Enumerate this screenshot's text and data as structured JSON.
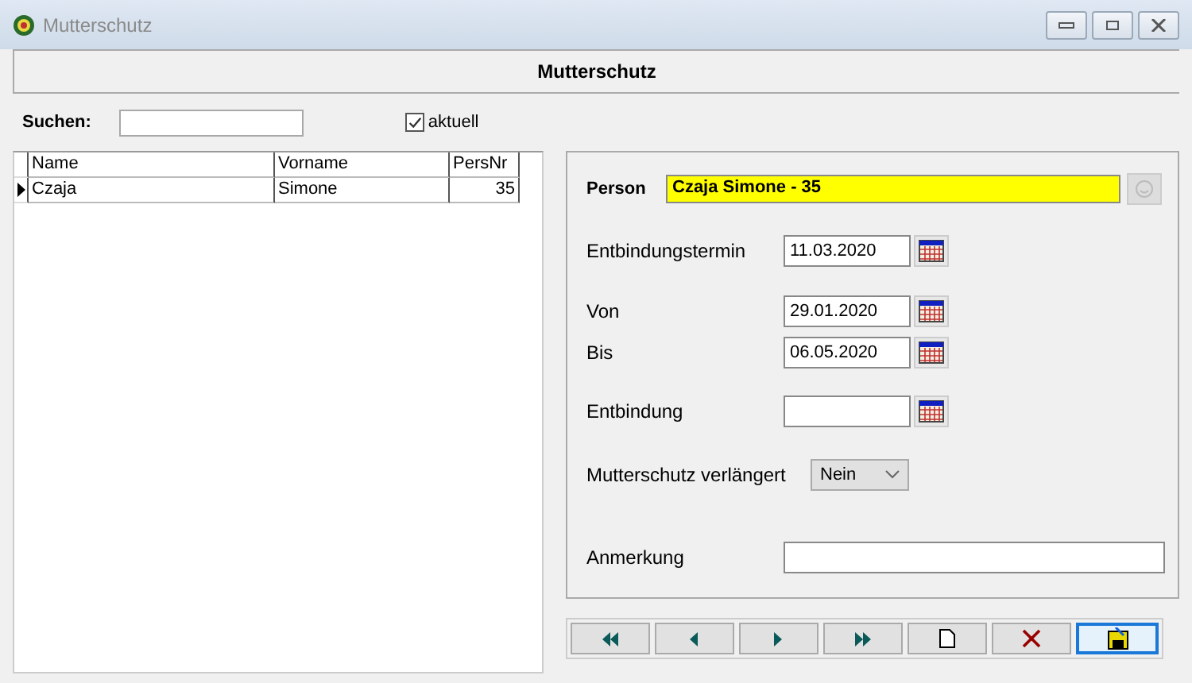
{
  "window": {
    "title": "Mutterschutz"
  },
  "header": "Mutterschutz",
  "search": {
    "label": "Suchen:"
  },
  "current_filter": {
    "label": "aktuell",
    "checked": true
  },
  "table": {
    "columns": [
      "Name",
      "Vorname",
      "PersNr"
    ],
    "rows": [
      {
        "cells": [
          "Czaja",
          "Simone",
          "35"
        ],
        "selected": true
      }
    ]
  },
  "form": {
    "person": {
      "label": "Person",
      "value": "Czaja Simone - 35"
    },
    "dates": [
      {
        "label": "Entbindungstermin",
        "value": "11.03.2020"
      },
      {
        "label": "Von",
        "value": "29.01.2020"
      },
      {
        "label": "Bis",
        "value": "06.05.2020"
      },
      {
        "label": "Entbindung"
      }
    ],
    "extended": {
      "label": "Mutterschutz verlängert",
      "value": "Nein"
    },
    "remark": {
      "label": "Anmerkung"
    }
  },
  "toolbar": [
    {
      "kind": "first",
      "focused": false
    },
    {
      "kind": "prev",
      "focused": false
    },
    {
      "kind": "next",
      "focused": false
    },
    {
      "kind": "last",
      "focused": false
    },
    {
      "kind": "new",
      "focused": false
    },
    {
      "kind": "delete",
      "focused": false
    },
    {
      "kind": "save",
      "focused": true
    }
  ]
}
